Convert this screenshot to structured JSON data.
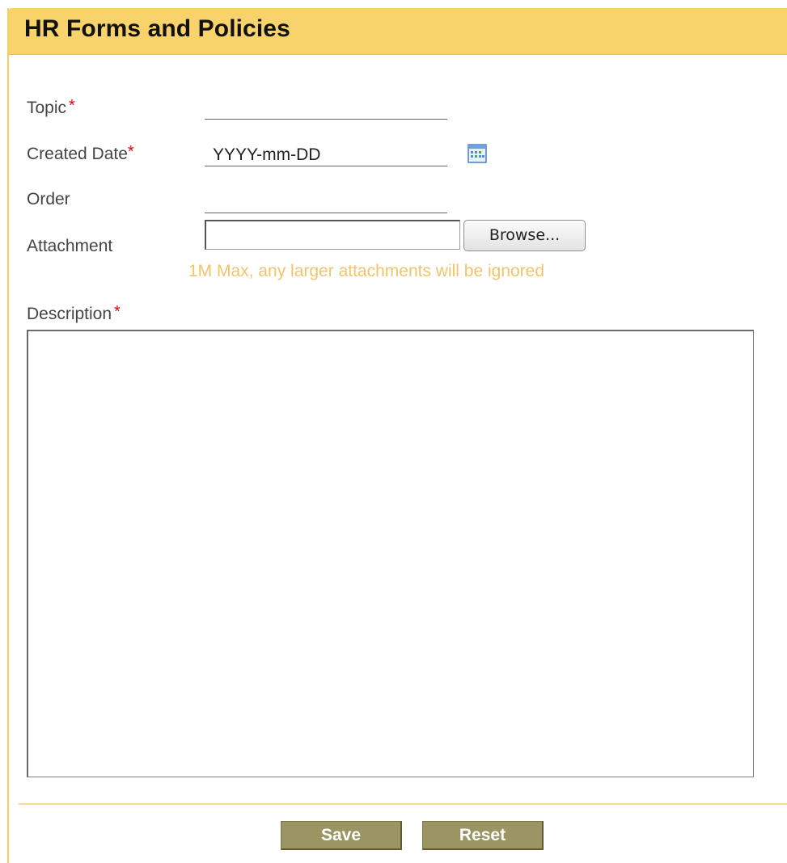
{
  "header": {
    "title": "HR Forms and Policies"
  },
  "form": {
    "topic": {
      "label": "Topic",
      "required_mark": "*",
      "value": ""
    },
    "created_date": {
      "label": "Created Date",
      "required_mark": "*",
      "value": "YYYY-mm-DD"
    },
    "order": {
      "label": "Order",
      "value": ""
    },
    "attachment": {
      "label": "Attachment",
      "browse_label": "Browse...",
      "hint": "1M Max, any larger attachments will be ignored"
    },
    "description": {
      "label": "Description",
      "required_mark": "*",
      "value": ""
    }
  },
  "actions": {
    "save_label": "Save",
    "reset_label": "Reset"
  },
  "colors": {
    "header_bg": "#f8d36b",
    "required": "#e60000",
    "hint": "#f2c46a",
    "button_bg": "#9a9563"
  }
}
